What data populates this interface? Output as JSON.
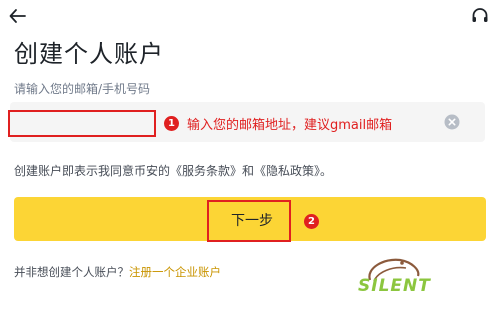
{
  "header": {
    "back_icon": "arrow-left-icon",
    "support_icon": "headset-icon"
  },
  "page_title": "创建个人账户",
  "form": {
    "label": "请输入您的邮箱/手机号码",
    "email_value": "",
    "clear_icon": "clear-circle-icon"
  },
  "annotations": {
    "badge_1": "1",
    "note_1": "输入您的邮箱地址，建议gmail邮箱",
    "badge_2": "2",
    "highlight_color": "#e02020"
  },
  "terms_text": "创建账户即表示我同意币安的《服务条款》和《隐私政策》。",
  "next_button": {
    "label": "下一步",
    "color": "#fcd535"
  },
  "enterprise": {
    "prompt": "并非想创建个人账户？",
    "link": "注册一个企业账户",
    "link_color": "#c99400"
  },
  "watermark": {
    "text": "SILENT",
    "color": "#8cc63f"
  }
}
